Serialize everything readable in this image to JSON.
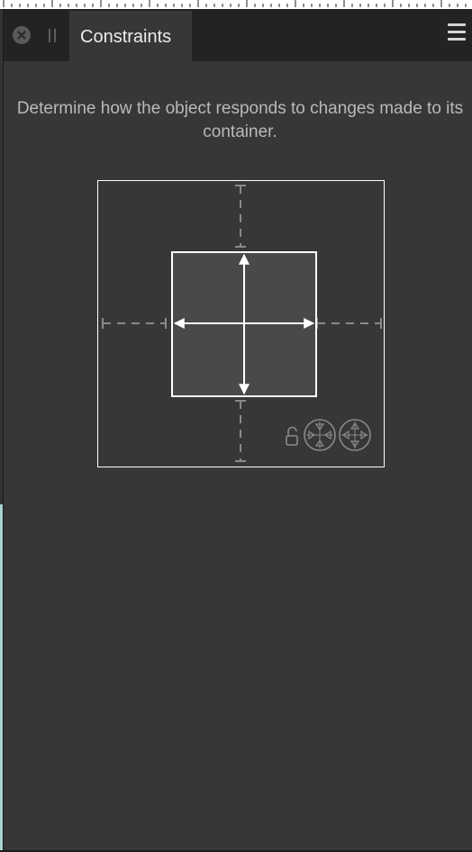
{
  "panel": {
    "tab_label": "Constraints",
    "description": "Determine how the object responds to changes made to its container."
  },
  "icons": {
    "close": "close-circle-icon",
    "grip": "drag-grip-icon",
    "menu": "hamburger-menu-icon",
    "lock": "lock-icon",
    "shrink": "scale-inward-icon",
    "expand": "scale-outward-icon"
  },
  "colors": {
    "panel_bg": "#373737",
    "tabbar_bg": "#232323",
    "inner_box_fill": "#494949",
    "guide_gray": "#8a8a8a",
    "arrow_white": "#ffffff"
  }
}
